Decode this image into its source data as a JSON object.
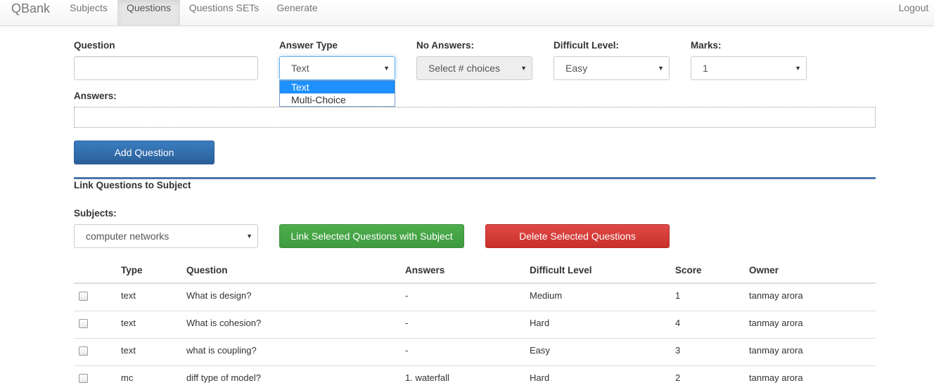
{
  "nav": {
    "brand": "QBank",
    "items": [
      "Subjects",
      "Questions",
      "Questions SETs",
      "Generate"
    ],
    "active": "Questions",
    "logout": "Logout"
  },
  "form": {
    "question_label": "Question",
    "question_value": "",
    "answer_type_label": "Answer Type",
    "answer_type_value": "Text",
    "answer_type_options": [
      "Text",
      "Multi-Choice"
    ],
    "no_answers_label": "No Answers:",
    "no_answers_value": "Select # choices",
    "difficult_label": "Difficult Level:",
    "difficult_value": "Easy",
    "marks_label": "Marks:",
    "marks_value": "1",
    "answers_label": "Answers:",
    "add_button": "Add Question"
  },
  "link": {
    "heading": "Link Questions to Subject",
    "subjects_label": "Subjects:",
    "subject_value": "computer networks",
    "link_button": "Link Selected Questions with Subject",
    "delete_button": "Delete Selected Questions"
  },
  "table": {
    "headers": [
      "Type",
      "Question",
      "Answers",
      "Difficult Level",
      "Score",
      "Owner"
    ],
    "rows": [
      {
        "type": "text",
        "question": "What is design?",
        "answers": "-",
        "level": "Medium",
        "score": "1",
        "owner": "tanmay arora"
      },
      {
        "type": "text",
        "question": "What is cohesion?",
        "answers": "-",
        "level": "Hard",
        "score": "4",
        "owner": "tanmay arora"
      },
      {
        "type": "text",
        "question": "what is coupling?",
        "answers": "-",
        "level": "Easy",
        "score": "3",
        "owner": "tanmay arora"
      },
      {
        "type": "mc",
        "question": "diff type of model?",
        "answers": "1. waterfall",
        "level": "Hard",
        "score": "2",
        "owner": "tanmay arora"
      }
    ]
  },
  "colors": {
    "primary": "#2e6da4",
    "success": "#449d44",
    "danger": "#d9534f",
    "dropdown_highlight": "#1e90ff"
  }
}
